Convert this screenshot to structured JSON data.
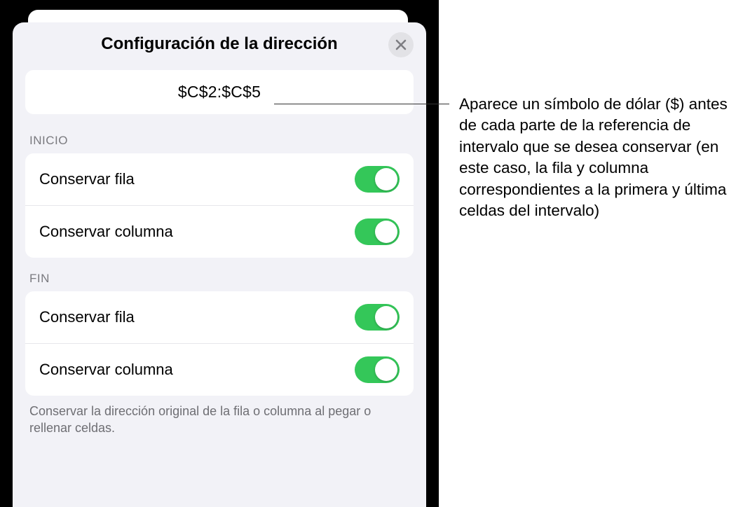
{
  "panel": {
    "title": "Configuración de la dirección",
    "reference": "$C$2:$C$5",
    "footnote": "Conservar la dirección original de la fila o columna al pegar o rellenar celdas."
  },
  "sections": {
    "start": {
      "header": "INICIO",
      "preserve_row": "Conservar fila",
      "preserve_column": "Conservar columna"
    },
    "end": {
      "header": "FIN",
      "preserve_row": "Conservar fila",
      "preserve_column": "Conservar columna"
    }
  },
  "callout": {
    "text": "Aparece un símbolo de dólar ($) antes de cada parte de la referencia de intervalo que se desea conservar (en este caso, la fila y columna correspondientes a la primera y última celdas del intervalo)"
  },
  "colors": {
    "toggle_on": "#34c759",
    "panel_bg": "#f2f2f7"
  }
}
